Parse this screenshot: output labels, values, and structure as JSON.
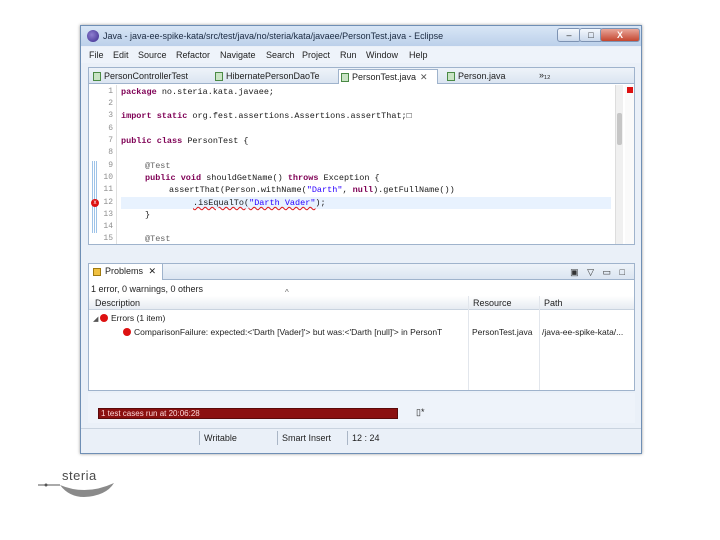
{
  "window": {
    "title": "Java - java-ee-spike-kata/src/test/java/no/steria/kata/javaee/PersonTest.java - Eclipse",
    "controls": {
      "minimize": "–",
      "maximize": "□",
      "close": "X"
    }
  },
  "menu": [
    "File",
    "Edit",
    "Source",
    "Refactor",
    "Navigate",
    "Search",
    "Project",
    "Run",
    "Window",
    "Help"
  ],
  "editor": {
    "tabs": [
      {
        "label": "PersonControllerTest",
        "active": false
      },
      {
        "label": "HibernatePersonDaoTe",
        "active": false
      },
      {
        "label": "PersonTest.java",
        "active": true,
        "close": "✕"
      },
      {
        "label": "Person.java",
        "active": false
      }
    ],
    "overflow": "»₁₂",
    "line_numbers": [
      "1",
      "2",
      "3",
      "6",
      "7",
      "8",
      "9",
      "10",
      "11",
      "12",
      "13",
      "14",
      "15"
    ],
    "code": {
      "l1_kw": "package",
      "l1_rest": " no.steria.kata.javaee;",
      "l3_kw": "import static",
      "l3_rest": " org.fest.assertions.Assertions.assertThat;",
      "l6_kw": "public class",
      "l6_rest": " PersonTest {",
      "l9_ann": "@Test",
      "l10_kw1": "public void",
      "l10_mid": " shouldGetName() ",
      "l10_kw2": "throws",
      "l10_rest": " Exception {",
      "l11_a": "assertThat(Person.withName(",
      "l11_s1": "\"Darth\"",
      "l11_b": ", ",
      "l11_kw": "null",
      "l11_c": ").getFullName())",
      "l12_a": ".isEqualTo(",
      "l12_s": "\"Darth Vader\"",
      "l12_b": ");",
      "l13": "}",
      "l15_ann": "@Test"
    }
  },
  "problems": {
    "tab_label": "Problems",
    "tab_close": "✕",
    "summary": "1 error, 0 warnings, 0 others",
    "columns": [
      "Description",
      "Resource",
      "Path"
    ],
    "group": "Errors (1 item)",
    "error": {
      "description": "ComparisonFailure: expected:<'Darth [Vader]'> but was:<'Darth [null]'> in PersonT",
      "resource": "PersonTest.java",
      "path": "/java-ee-spike-kata/..."
    }
  },
  "junit": {
    "status": "1 test cases run at 20:06:28"
  },
  "status_bar": {
    "writable": "Writable",
    "insert_mode": "Smart Insert",
    "position": "12 : 24"
  },
  "logo": {
    "text": "steria"
  }
}
